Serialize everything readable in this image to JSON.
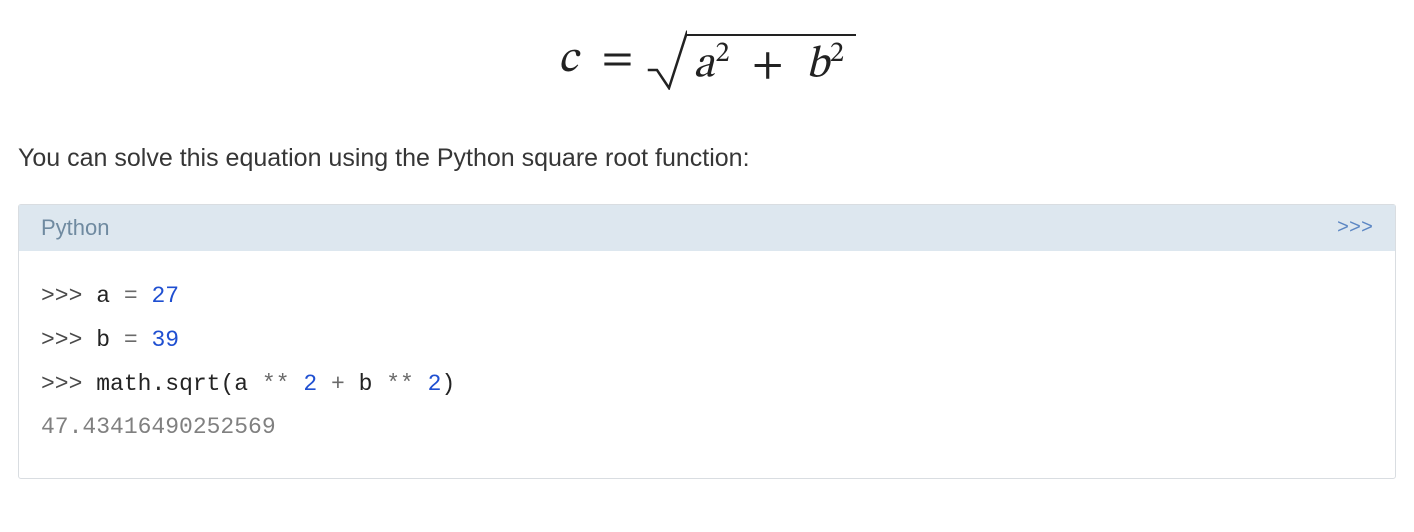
{
  "equation": {
    "lhs": "c",
    "equals": "=",
    "radicand": {
      "a": "a",
      "a_exp": "2",
      "plus": "+",
      "b": "b",
      "b_exp": "2"
    }
  },
  "paragraph": "You can solve this equation using the Python square root function:",
  "codeblock": {
    "language": "Python",
    "prompt_indicator": ">>>",
    "lines": {
      "l1": {
        "prompt": ">>>",
        "var": "a",
        "assign": "=",
        "value": "27"
      },
      "l2": {
        "prompt": ">>>",
        "var": "b",
        "assign": "=",
        "value": "39"
      },
      "l3": {
        "prompt": ">>>",
        "mod": "math",
        "dot": ".",
        "func": "sqrt",
        "open": "(",
        "arg_a": "a",
        "star1": "**",
        "two1": "2",
        "plus": "+",
        "arg_b": "b",
        "star2": "**",
        "two2": "2",
        "close": ")"
      },
      "output": "47.43416490252569"
    }
  }
}
